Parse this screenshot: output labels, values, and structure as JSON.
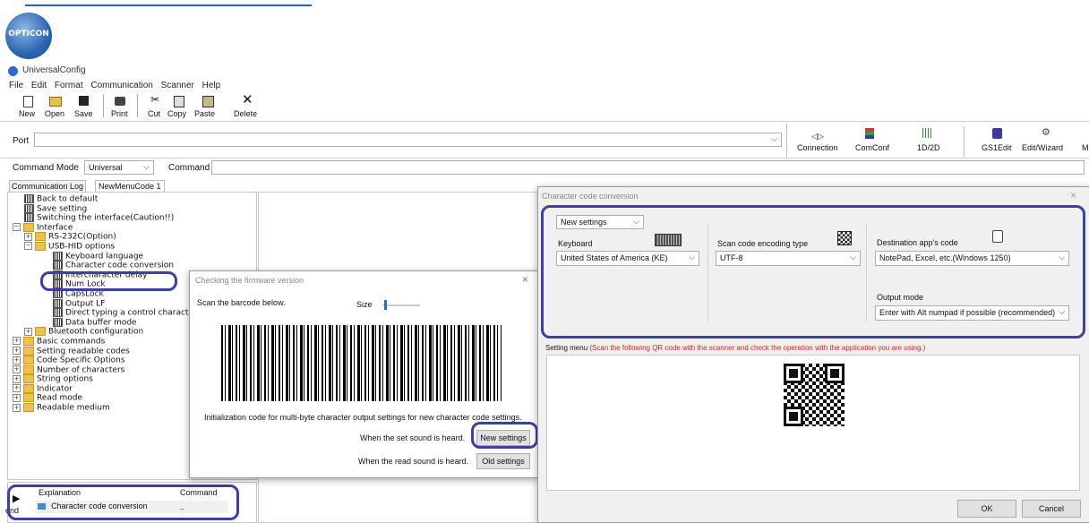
{
  "top_link": "",
  "logo_text": "OPTICON",
  "app_title": "UniversalConfig",
  "menu": [
    "File",
    "Edit",
    "Format",
    "Communication",
    "Scanner",
    "Help"
  ],
  "toolbar": [
    "New",
    "Open",
    "Save",
    "Print",
    "Cut",
    "Copy",
    "Paste",
    "Delete"
  ],
  "port_label": "Port",
  "ribbon": [
    "Connection",
    "ComConf",
    "1D/2D",
    "GS1Edit",
    "Edit/Wizard",
    "M"
  ],
  "command_mode_label": "Command Mode",
  "command_mode_value": "Universal",
  "command_label": "Command",
  "tabs": [
    "Communication Log",
    "NewMenuCode 1"
  ],
  "tree": {
    "back_to_default": "Back to default",
    "save_setting": "Save setting",
    "switching": "Switching the interface(Caution!!)",
    "interface": "Interface",
    "rs232c": "RS-232C(Option)",
    "usb_hid": "USB-HID options",
    "keyboard_language": "Keyboard language",
    "char_code_conversion": "Character code conversion",
    "intercharacter_delay": "Intercharacter delay",
    "num_lock": "Num Lock",
    "caps_lock": "CapsLock",
    "output_lf": "Output LF",
    "direct_typing": "Direct typing a control character",
    "data_buffer": "Data buffer mode",
    "bluetooth": "Bluetooth configuration",
    "basic_commands": "Basic commands",
    "setting_readable": "Setting readable codes",
    "code_specific": "Code Specific Options",
    "number_of_chars": "Number of characters",
    "string_options": "String options",
    "indicator": "Indicator",
    "read_mode": "Read mode",
    "readable_medium": "Readable medium"
  },
  "explanation": {
    "col1": "Explanation",
    "col2": "Command",
    "row_text": "Character code conversion",
    "row_cmd": "..",
    "send_label": "end"
  },
  "firmware_dialog": {
    "title": "Checking the firmware version",
    "close": "×",
    "scan_text": "Scan the barcode below.",
    "size_label": "Size",
    "init_text": "Initialization code for multi-byte character output settings for new character code settings.",
    "set_sound_text": "When the set sound is heard.",
    "new_settings_btn": "New settings",
    "read_sound_text": "When the read sound is heard.",
    "old_settings_btn": "Old settings"
  },
  "ccc_dialog": {
    "title": "Character code conversion",
    "close": "×",
    "preset_value": "New settings",
    "keyboard_label": "Keyboard",
    "keyboard_value": "United States of America (KE)",
    "scan_encoding_label": "Scan code encoding type",
    "scan_encoding_value": "UTF-8",
    "dest_code_label": "Destination app's code",
    "dest_code_value": "NotePad, Excel, etc.(Windows 1250)",
    "output_mode_label": "Output mode",
    "output_mode_value": "Enter with Alt numpad if possible (recommended)",
    "setting_menu_label": "Setting menu",
    "setting_menu_note": "(Scan the following QR code with the scanner and check the operation with the application you are using.)",
    "ok_btn": "OK",
    "cancel_btn": "Cancel",
    "note_color": "#e02020"
  },
  "accent_color": "#3c3fa8"
}
